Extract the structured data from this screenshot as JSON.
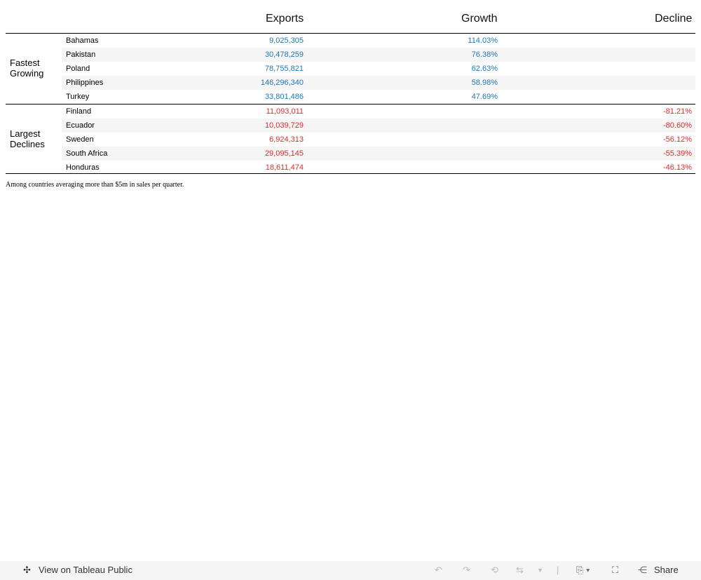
{
  "headers": {
    "exports": "Exports",
    "growth": "Growth",
    "decline": "Decline"
  },
  "groups": [
    {
      "label": "Fastest Growing",
      "rows": [
        {
          "country": "Bahamas",
          "exports": "9,025,305",
          "growth": "114.03%"
        },
        {
          "country": "Pakistan",
          "exports": "30,478,259",
          "growth": "76.38%"
        },
        {
          "country": "Poland",
          "exports": "78,755,821",
          "growth": "62.63%"
        },
        {
          "country": "Philippines",
          "exports": "146,296,340",
          "growth": "58.98%"
        },
        {
          "country": "Turkey",
          "exports": "33,801,486",
          "growth": "47.69%"
        }
      ]
    },
    {
      "label": "Largest Declines",
      "rows": [
        {
          "country": "Finland",
          "exports": "11,093,011",
          "decline": "-81.21%"
        },
        {
          "country": "Ecuador",
          "exports": "10,039,729",
          "decline": "-80.60%"
        },
        {
          "country": "Sweden",
          "exports": "6,924,313",
          "decline": "-56.12%"
        },
        {
          "country": "South Africa",
          "exports": "29,095,145",
          "decline": "-55.39%"
        },
        {
          "country": "Honduras",
          "exports": "18,611,474",
          "decline": "-46.13%"
        }
      ]
    }
  ],
  "note": "Among countries averaging more than $5m in sales per quarter.",
  "toolbar": {
    "view_label": "View on Tableau Public",
    "share_label": "Share"
  },
  "colors": {
    "positive": "#1f77b4",
    "negative": "#e0272b"
  }
}
